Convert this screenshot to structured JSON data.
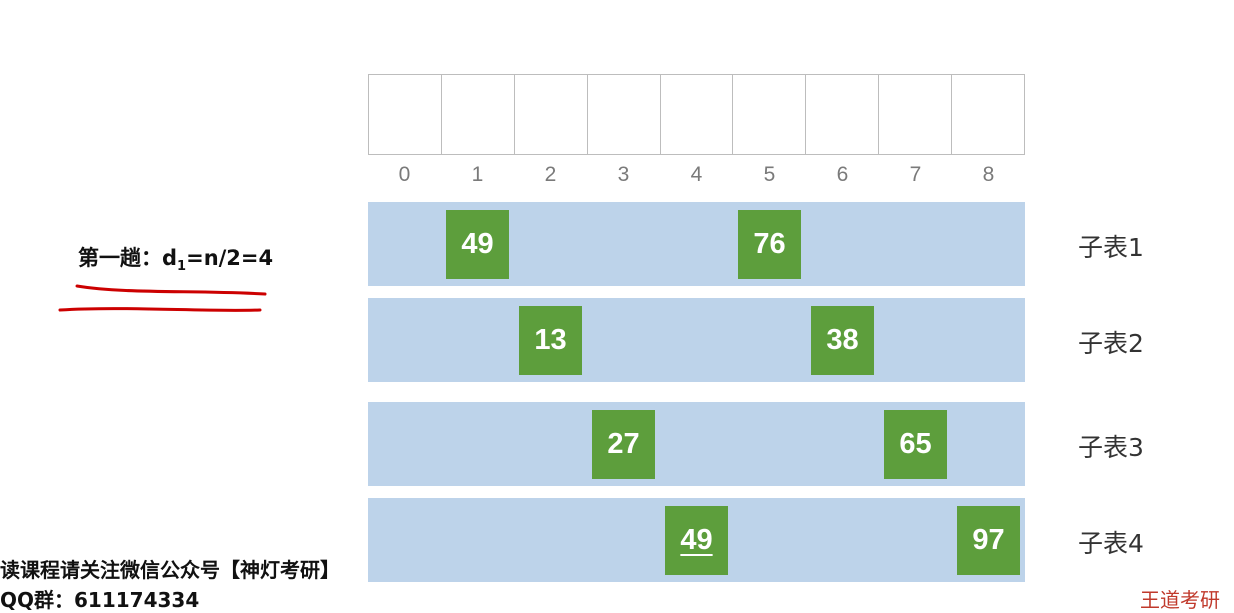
{
  "pass": {
    "label_prefix": "第一趟：d",
    "subscript": "1",
    "label_suffix": "=n/2=4"
  },
  "array_indices": [
    "0",
    "1",
    "2",
    "3",
    "4",
    "5",
    "6",
    "7",
    "8"
  ],
  "sublists": [
    {
      "label": "子表1",
      "elements": [
        {
          "value": "49",
          "index": 1
        },
        {
          "value": "76",
          "index": 5
        }
      ]
    },
    {
      "label": "子表2",
      "elements": [
        {
          "value": "13",
          "index": 2
        },
        {
          "value": "38",
          "index": 6
        }
      ]
    },
    {
      "label": "子表3",
      "elements": [
        {
          "value": "27",
          "index": 3
        },
        {
          "value": "65",
          "index": 7
        }
      ]
    },
    {
      "label": "子表4",
      "elements": [
        {
          "value": "49",
          "index": 4,
          "underlined": true
        },
        {
          "value": "97",
          "index": 8
        }
      ]
    }
  ],
  "footer": {
    "line1": "读课程请关注微信公众号【神灯考研】",
    "line2": "QQ群：611174334",
    "right": "王道考研"
  },
  "colors": {
    "element_fill": "#5d9e3c",
    "sublist_band": "#bdd3ea",
    "annotation": "#cc0000"
  }
}
